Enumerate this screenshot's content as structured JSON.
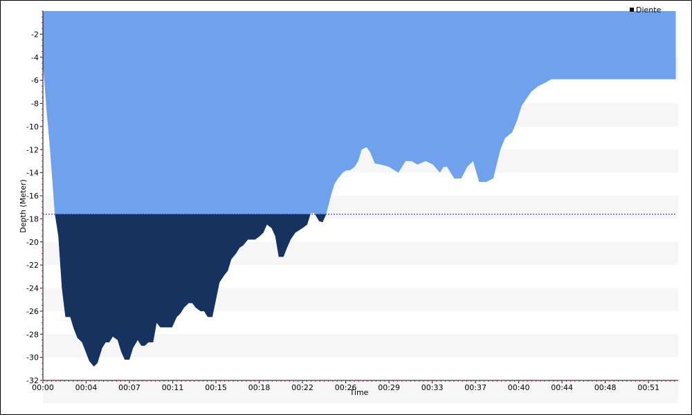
{
  "chart_data": {
    "type": "area",
    "xlabel": "Time",
    "ylabel": "Depth (Meter)",
    "legend": {
      "position": "top-right",
      "entries": [
        "Diente"
      ]
    },
    "x_tick_labels": [
      "00:00",
      "00:04",
      "00:07",
      "00:11",
      "00:15",
      "00:18",
      "00:22",
      "00:26",
      "00:29",
      "00:33",
      "00:37",
      "00:40",
      "00:44",
      "00:48",
      "00:51"
    ],
    "x_ticks_minutes": [
      0,
      3.65,
      7.3,
      10.95,
      14.6,
      18.25,
      21.9,
      25.55,
      29.2,
      32.85,
      36.5,
      40.15,
      43.8,
      47.45,
      51.1
    ],
    "xlim": [
      0,
      53.6
    ],
    "ylim": [
      -32,
      0
    ],
    "y_ticks": [
      -2,
      -4,
      -6,
      -8,
      -10,
      -12,
      -14,
      -16,
      -18,
      -20,
      -22,
      -24,
      -26,
      -28,
      -30,
      -32
    ],
    "reference_line_depth": -17.6,
    "colors": {
      "profile_fill": "#70a1ec",
      "below_reference_fill": "#16325f",
      "band": "#f6f6f6",
      "reference_line": "#2222cc"
    },
    "series": [
      {
        "name": "Diente",
        "x": [
          0,
          0.3,
          0.6,
          1.0,
          1.3,
          1.6,
          1.9,
          2.3,
          2.6,
          2.9,
          3.3,
          3.6,
          3.9,
          4.3,
          4.6,
          5.0,
          5.3,
          5.6,
          5.9,
          6.3,
          6.6,
          6.9,
          7.3,
          7.6,
          8.0,
          8.3,
          8.6,
          8.9,
          9.3,
          9.6,
          9.9,
          10.3,
          10.6,
          10.9,
          11.3,
          11.6,
          11.9,
          12.3,
          12.6,
          12.9,
          13.3,
          13.6,
          13.9,
          14.3,
          14.6,
          14.9,
          15.3,
          15.6,
          15.9,
          16.3,
          16.6,
          16.9,
          17.3,
          17.6,
          17.9,
          18.3,
          18.6,
          18.9,
          19.3,
          19.6,
          19.9,
          20.3,
          20.6,
          20.9,
          21.3,
          21.6,
          21.9,
          22.3,
          22.6,
          22.9,
          23.3,
          23.6,
          23.9,
          24.3,
          24.6,
          24.9,
          25.3,
          25.6,
          25.9,
          26.3,
          26.6,
          26.9,
          27.3,
          27.6,
          28.0,
          28.5,
          29.2,
          30.0,
          30.6,
          31.1,
          31.6,
          32.3,
          32.9,
          33.5,
          33.8,
          34.1,
          34.7,
          35.3,
          35.8,
          36.3,
          36.8,
          37.4,
          38.0,
          38.6,
          39.0,
          39.6,
          40.0,
          40.4,
          40.8,
          41.2,
          41.8,
          42.4,
          42.9,
          43.4,
          44.0,
          44.4,
          44.8,
          45.2,
          45.7,
          46.2,
          46.8,
          47.3,
          47.7,
          48.2,
          48.6,
          49.0,
          49.6,
          50.2,
          50.8,
          51.3,
          51.6,
          51.9,
          52.3,
          52.7,
          53.1,
          53.4
        ],
        "y": [
          -4.5,
          -8.5,
          -12,
          -17.5,
          -19.5,
          -24,
          -26.5,
          -26.5,
          -27.5,
          -28.3,
          -28.7,
          -29.5,
          -30.3,
          -30.8,
          -30.5,
          -29.2,
          -28.7,
          -28.7,
          -28.2,
          -28.5,
          -29.5,
          -30.2,
          -30.2,
          -29.2,
          -28.5,
          -29,
          -29,
          -28.7,
          -28.7,
          -27,
          -27.4,
          -27.4,
          -27.4,
          -27.4,
          -26.5,
          -26.2,
          -25.7,
          -25.3,
          -25.3,
          -25.7,
          -26,
          -26,
          -26.5,
          -26.5,
          -25,
          -23.5,
          -22.9,
          -22.5,
          -21.5,
          -21,
          -20.5,
          -20.3,
          -19.8,
          -19.8,
          -19.8,
          -19.5,
          -19.2,
          -18.5,
          -18.8,
          -19.5,
          -21.3,
          -21.3,
          -20.5,
          -19.8,
          -19.2,
          -19,
          -18.8,
          -18.5,
          -17.5,
          -17.5,
          -18.2,
          -18.3,
          -17.6,
          -16,
          -15,
          -14.5,
          -14,
          -13.8,
          -13.8,
          -13.5,
          -13,
          -12,
          -11.8,
          -12.2,
          -13.2,
          -13.3,
          -13.5,
          -14,
          -13,
          -13,
          -13.3,
          -13,
          -13.3,
          -14,
          -13.5,
          -13.5,
          -14.5,
          -14.5,
          -13.5,
          -13,
          -14.8,
          -14.8,
          -14.5,
          -12,
          -11,
          -10.5,
          -9.5,
          -8.2,
          -7.6,
          -7,
          -6.5,
          -6.2,
          -5.9,
          -5.9,
          -5.9,
          -5.9,
          -5.9,
          -5.9,
          -5.9,
          -5.9,
          -5.9,
          -5.9,
          -5.9,
          -5.9,
          -5.9,
          -5.9,
          -5.9,
          -5.9,
          -5.9,
          -5.9,
          -5.9,
          -5.9,
          -5.9,
          -5.9,
          -5.9,
          -5.9
        ]
      }
    ]
  }
}
